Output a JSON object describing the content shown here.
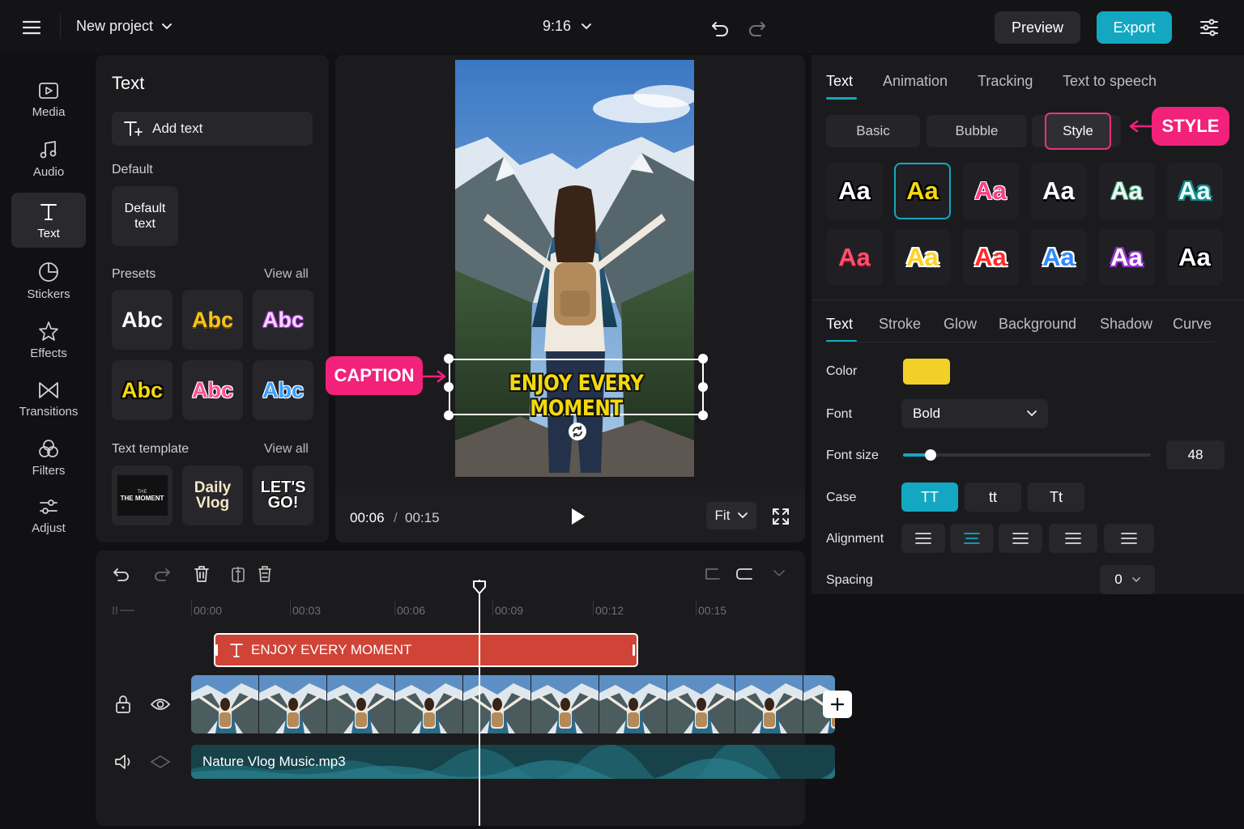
{
  "topbar": {
    "project_title": "New project",
    "aspect_ratio": "9:16",
    "preview_label": "Preview",
    "export_label": "Export"
  },
  "nav": {
    "items": [
      {
        "label": "Media",
        "icon": "media-icon"
      },
      {
        "label": "Audio",
        "icon": "music-note-icon"
      },
      {
        "label": "Text",
        "icon": "text-icon"
      },
      {
        "label": "Stickers",
        "icon": "sticker-icon"
      },
      {
        "label": "Effects",
        "icon": "star-icon"
      },
      {
        "label": "Transitions",
        "icon": "transition-icon"
      },
      {
        "label": "Filters",
        "icon": "filters-icon"
      },
      {
        "label": "Adjust",
        "icon": "adjust-icon"
      }
    ],
    "active": "Text"
  },
  "text_panel": {
    "title": "Text",
    "add_text_label": "Add text",
    "default_label": "Default",
    "default_card": "Default\ntext",
    "presets_label": "Presets",
    "view_all": "View all",
    "presets": [
      "Abc",
      "Abc",
      "Abc",
      "Abc",
      "Abc",
      "Abc"
    ],
    "template_label": "Text template",
    "templates": [
      "THE MOMENT",
      "Daily\nVlog",
      "LET'S\nGO!"
    ],
    "template_1_small": "THE"
  },
  "preview": {
    "caption_text": "ENJOY EVERY MOMENT",
    "time_current": "00:06",
    "time_separator": "/",
    "time_total": "00:15",
    "fit_label": "Fit",
    "callout_caption": "CAPTION"
  },
  "right_panel": {
    "tabs": [
      "Text",
      "Animation",
      "Tracking",
      "Text to speech"
    ],
    "active_tab": "Text",
    "style_buttons": [
      "Basic",
      "Bubble",
      "Style"
    ],
    "active_style": "Style",
    "callout_style": "STYLE",
    "style_tiles": [
      "Aa",
      "Aa",
      "Aa",
      "Aa",
      "Aa",
      "Aa",
      "Aa",
      "Aa",
      "Aa",
      "Aa",
      "Aa",
      "Aa"
    ],
    "subtabs": [
      "Text",
      "Stroke",
      "Glow",
      "Background",
      "Shadow",
      "Curve"
    ],
    "active_subtab": "Text",
    "color_label": "Color",
    "color_value": "#f3d028",
    "font_label": "Font",
    "font_value": "Bold",
    "font_size_label": "Font size",
    "font_size_value": "48",
    "font_size_slider_fraction": 0.11,
    "case_label": "Case",
    "case_options": [
      "TT",
      "tt",
      "Tt"
    ],
    "case_active": "TT",
    "alignment_label": "Alignment",
    "spacing_label": "Spacing",
    "spacing_value": "0"
  },
  "timeline": {
    "ruler": [
      "00:00",
      "00:03",
      "00:06",
      "00:09",
      "00:12",
      "00:15"
    ],
    "text_clip_label": "ENJOY EVERY MOMENT",
    "audio_clip_label": "Nature Vlog Music.mp3"
  },
  "colors": {
    "accent": "#14a7c1",
    "callout": "#f2217a",
    "caption_yellow": "#f5d90c",
    "text_clip": "#cf4437"
  }
}
